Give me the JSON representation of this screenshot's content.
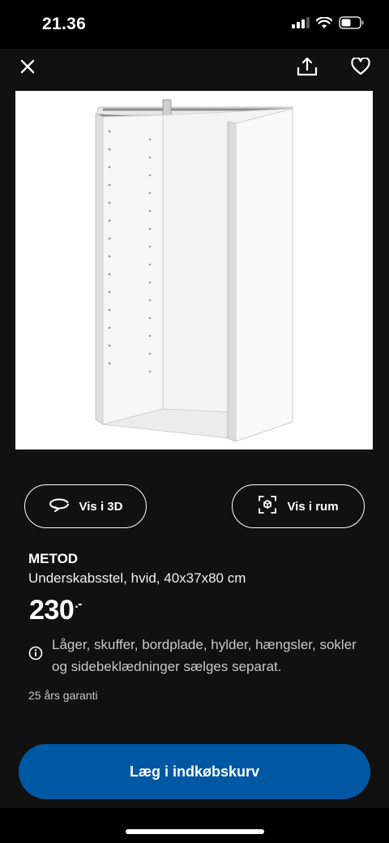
{
  "status_bar": {
    "time": "21.36",
    "icons": [
      "signal-icon",
      "wifi-icon",
      "battery-icon"
    ]
  },
  "top_bar": {
    "icons": [
      "close-icon",
      "share-icon",
      "heart-icon"
    ]
  },
  "product": {
    "image_subject": "white-cabinet-frame",
    "name": "METOD",
    "description": "Underskabsstel, hvid, 40x37x80 cm",
    "price": "230",
    "price_suffix": ".-",
    "info_text": "Låger, skuffer, bordplade, hylder, hængsler, sokler og sidebeklædninger sælges separat.",
    "guarantee": "25 års garanti"
  },
  "actions": {
    "view_3d_label": "Vis i 3D",
    "view_room_label": "Vis i rum",
    "add_to_cart_label": "Læg i indkøbskurv"
  },
  "colors": {
    "background": "#111111",
    "accent": "#0058a3",
    "text": "#ffffff",
    "muted_text": "#c8c8c8"
  }
}
